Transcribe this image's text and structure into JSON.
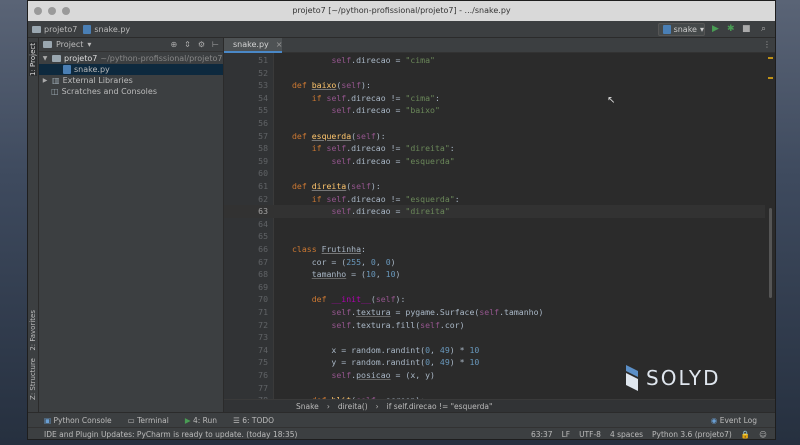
{
  "window": {
    "title": "projeto7 [~/python-profissional/projeto7] - .../snake.py"
  },
  "navbar": {
    "crumbs": [
      "projeto7",
      "snake.py"
    ],
    "run_config": "snake"
  },
  "sidebar_tabs": {
    "project": "1: Project",
    "favorites": "2: Favorites",
    "structure": "Z: Structure"
  },
  "project_panel": {
    "header": "Project",
    "tree": [
      {
        "name": "projeto7",
        "path": "~/python-profissional/projeto7"
      },
      {
        "name": "snake.py"
      },
      {
        "name": "External Libraries"
      },
      {
        "name": "Scratches and Consoles"
      }
    ]
  },
  "editor": {
    "tab": "snake.py",
    "lines": [
      {
        "n": "51"
      },
      {
        "n": "52"
      },
      {
        "n": "53"
      },
      {
        "n": "54"
      },
      {
        "n": "55"
      },
      {
        "n": "56"
      },
      {
        "n": "57"
      },
      {
        "n": "58"
      },
      {
        "n": "59"
      },
      {
        "n": "60"
      },
      {
        "n": "61"
      },
      {
        "n": "62"
      },
      {
        "n": "63"
      },
      {
        "n": "64"
      },
      {
        "n": "65"
      },
      {
        "n": "66"
      },
      {
        "n": "67"
      },
      {
        "n": "68"
      },
      {
        "n": "69"
      },
      {
        "n": "70"
      },
      {
        "n": "71"
      },
      {
        "n": "72"
      },
      {
        "n": "73"
      },
      {
        "n": "74"
      },
      {
        "n": "75"
      },
      {
        "n": "76"
      },
      {
        "n": "77"
      },
      {
        "n": "78"
      }
    ],
    "breadcrumb": [
      "Snake",
      "direita()",
      "if self.direcao != \"esquerda\""
    ]
  },
  "toolwindows": {
    "python_console": "Python Console",
    "terminal": "Terminal",
    "run": "4: Run",
    "todo": "6: TODO",
    "event_log": "Event Log"
  },
  "status": {
    "message": "IDE and Plugin Updates: PyCharm is ready to update. (today 18:35)",
    "position": "63:37",
    "line_sep": "LF",
    "encoding": "UTF-8",
    "indent": "4 spaces",
    "interpreter": "Python 3.6 (projeto7)"
  },
  "watermark": "SOLYD",
  "colors": {
    "keyword": "#cc7832",
    "string": "#6a8759",
    "number": "#6897bb",
    "self": "#94558d",
    "function": "#ffc66d",
    "accent": "#4a88c7"
  }
}
